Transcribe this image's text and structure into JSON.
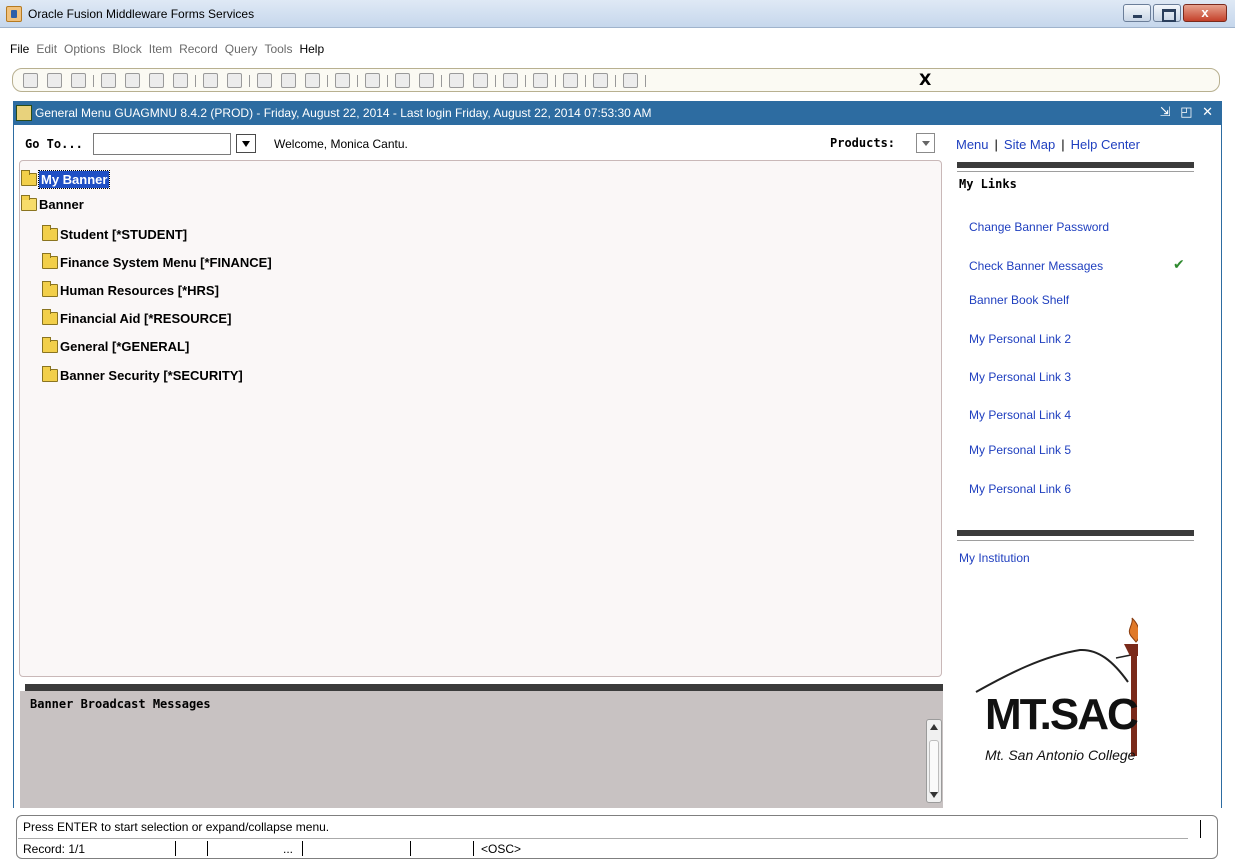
{
  "window": {
    "title": "Oracle Fusion Middleware Forms Services",
    "close_glyph": "x"
  },
  "menubar": [
    "File",
    "Edit",
    "Options",
    "Block",
    "Item",
    "Record",
    "Query",
    "Tools",
    "Help"
  ],
  "toolbar": {
    "exit_label": "X"
  },
  "form": {
    "title": "General Menu  GUAGMNU  8.4.2  (PROD) - Friday, August 22, 2014 - Last login Friday, August 22, 2014 07:53:30 AM",
    "controls": "⇲ ◰ ✕"
  },
  "goto": {
    "label": "Go To...",
    "value": ""
  },
  "welcome": "Welcome, Monica Cantu.",
  "products_label": "Products:",
  "tree": [
    {
      "label": "My Banner",
      "selected": true
    },
    {
      "label": "Banner"
    },
    {
      "label": "Student [*STUDENT]"
    },
    {
      "label": "Finance System Menu [*FINANCE]"
    },
    {
      "label": "Human Resources [*HRS]"
    },
    {
      "label": "Financial Aid [*RESOURCE]"
    },
    {
      "label": "General [*GENERAL]"
    },
    {
      "label": "Banner Security [*SECURITY]"
    }
  ],
  "broadcast_title": "Banner Broadcast Messages",
  "top_links": {
    "menu": "Menu",
    "site_map": "Site Map",
    "help_center": "Help Center",
    "sep": "|"
  },
  "my_links": {
    "title": "My Links",
    "items": [
      "Change Banner Password",
      "Check Banner Messages",
      "Banner Book Shelf",
      "My Personal Link 2",
      "My Personal Link 3",
      "My Personal Link 4",
      "My Personal Link 5",
      "My Personal Link 6"
    ],
    "check_glyph": "✔"
  },
  "institution": "My Institution",
  "logo": {
    "main": "MT.SAC",
    "sub": "Mt. San Antonio College"
  },
  "status": {
    "message": "Press ENTER to start selection or expand/collapse menu.",
    "record": "Record: 1/1",
    "ellipsis": "...",
    "osc": "<OSC>"
  }
}
